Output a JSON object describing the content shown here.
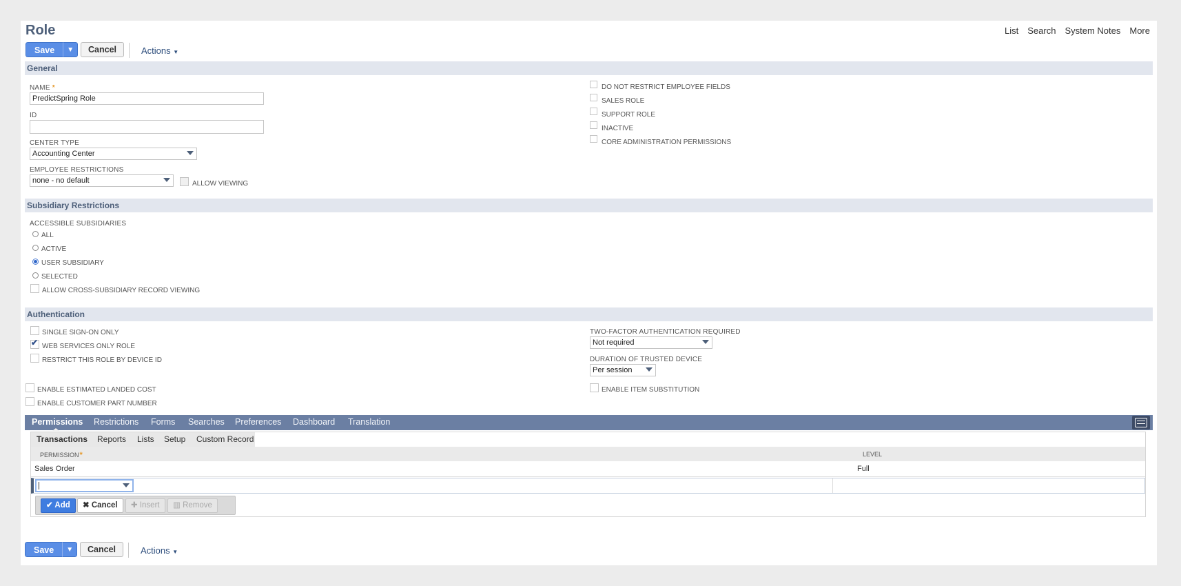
{
  "page_title": "Role",
  "top_links": [
    "List",
    "Search",
    "System Notes",
    "More"
  ],
  "toolbar": {
    "save_label": "Save",
    "save_menu": "▼",
    "cancel_label": "Cancel",
    "actions_label": "Actions"
  },
  "general": {
    "header": "General",
    "name_label": "NAME",
    "name_required": "*",
    "name_value": "PredictSpring Role",
    "id_label": "ID",
    "id_value": "",
    "center_type_label": "CENTER TYPE",
    "center_type_value": "Accounting Center",
    "employee_restrictions_label": "EMPLOYEE RESTRICTIONS",
    "employee_restrictions_value": "none - no default",
    "allow_viewing_label": "ALLOW VIEWING",
    "right_checkboxes": [
      "DO NOT RESTRICT EMPLOYEE FIELDS",
      "SALES ROLE",
      "SUPPORT ROLE",
      "INACTIVE",
      "CORE ADMINISTRATION PERMISSIONS"
    ]
  },
  "subsidiary": {
    "header": "Subsidiary Restrictions",
    "accessible_label": "ACCESSIBLE SUBSIDIARIES",
    "options": [
      "ALL",
      "ACTIVE",
      "USER SUBSIDIARY",
      "SELECTED"
    ],
    "selected_option": "USER SUBSIDIARY",
    "cross_label": "ALLOW CROSS-SUBSIDIARY RECORD VIEWING"
  },
  "authentication": {
    "header": "Authentication",
    "sso_label": "SINGLE SIGN-ON ONLY",
    "web_services_label": "WEB SERVICES ONLY ROLE",
    "web_services_checked": true,
    "device_label": "RESTRICT THIS ROLE BY DEVICE ID",
    "two_factor_label": "TWO-FACTOR AUTHENTICATION REQUIRED",
    "two_factor_value": "Not required",
    "duration_label": "DURATION OF TRUSTED DEVICE",
    "duration_value": "Per session",
    "landed_cost_label": "ENABLE ESTIMATED LANDED COST",
    "customer_part_label": "ENABLE CUSTOMER PART NUMBER",
    "item_sub_label": "ENABLE ITEM SUBSTITUTION"
  },
  "tabs": [
    "Permissions",
    "Restrictions",
    "Forms",
    "Searches",
    "Preferences",
    "Dashboard",
    "Translation"
  ],
  "active_tab": "Permissions",
  "subtabs": [
    "Transactions",
    "Reports",
    "Lists",
    "Setup",
    "Custom Record"
  ],
  "active_subtab": "Transactions",
  "permissions_table": {
    "headers": {
      "permission": "PERMISSION",
      "level": "LEVEL"
    },
    "required": "*",
    "rows": [
      {
        "permission": "Sales Order",
        "level": "Full"
      }
    ],
    "edit_value": ""
  },
  "machine_buttons": {
    "add": "Add",
    "cancel": "Cancel",
    "insert": "Insert",
    "remove": "Remove"
  },
  "colors": {
    "accent": "#5a8ee6",
    "section_bg": "#e2e6ee",
    "tab_bar": "#6b7fa3",
    "title": "#4d5f79",
    "required": "#e59a2d"
  }
}
